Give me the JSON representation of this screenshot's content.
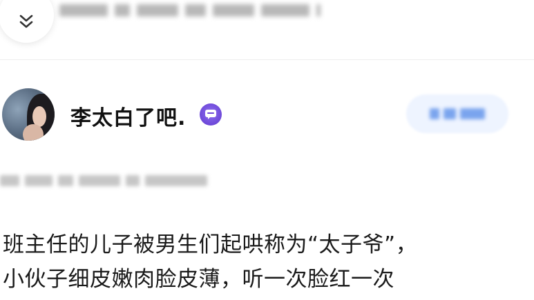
{
  "header": {
    "collapse_icon": "chevron-double-down-icon"
  },
  "author": {
    "name": "李太白了吧.",
    "badge_icon": "chat-bubble-badge-icon",
    "badge_color": "#6d48d8"
  },
  "follow_button": {
    "accent": "#7aa4ee"
  },
  "post": {
    "lines": [
      "班主任的儿子被男生们起哄称为“太子爷”，",
      "小伙子细皮嫩肉脸皮薄，听一次脸红一次"
    ]
  }
}
